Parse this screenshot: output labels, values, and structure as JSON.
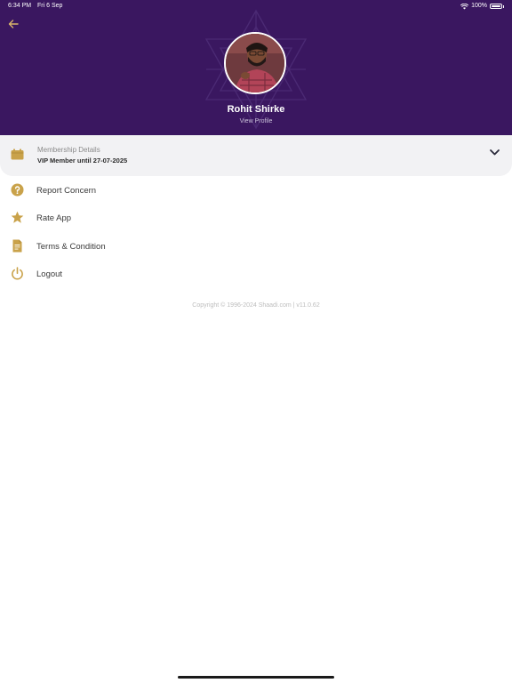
{
  "status_bar": {
    "time": "6:34 PM",
    "date": "Fri 6 Sep",
    "battery": "100%"
  },
  "profile": {
    "name": "Rohit Shirke",
    "view_profile_label": "View Profile"
  },
  "membership": {
    "title": "Membership Details",
    "status": "VIP Member until 27-07-2025"
  },
  "menu": {
    "items": [
      {
        "label": "Report Concern",
        "icon": "help-circle-icon"
      },
      {
        "label": "Rate App",
        "icon": "star-icon"
      },
      {
        "label": "Terms & Condition",
        "icon": "document-icon"
      },
      {
        "label": "Logout",
        "icon": "power-icon"
      }
    ]
  },
  "footer": {
    "copyright": "Copyright © 1996-2024 Shaadi.com | v11.0.62"
  },
  "colors": {
    "header_bg": "#3a1760",
    "accent_gold": "#c9a24a",
    "panel_bg": "#f2f2f4"
  }
}
